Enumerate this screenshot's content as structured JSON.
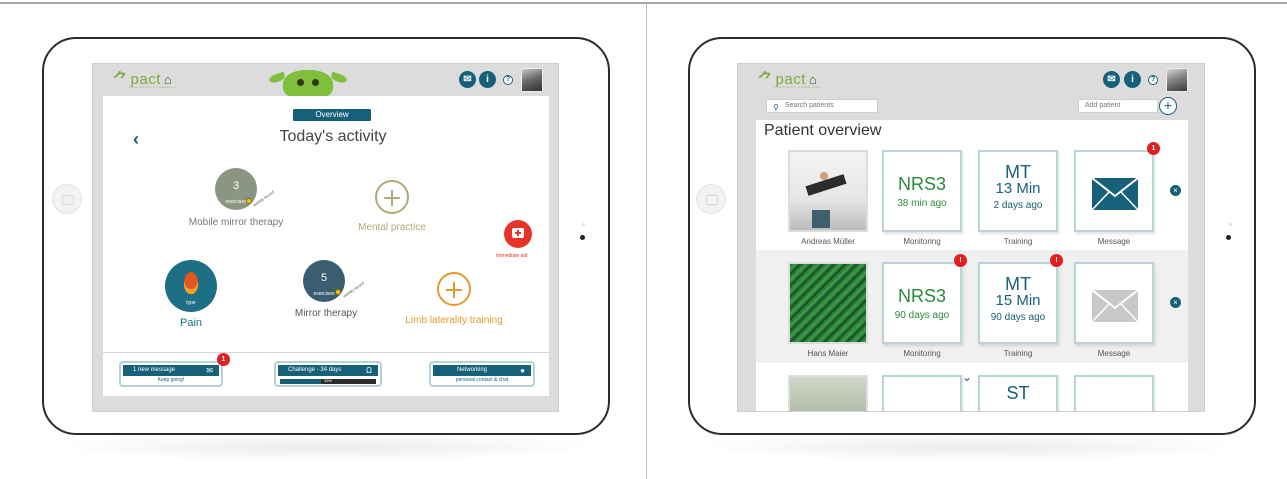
{
  "left_tablet": {
    "overview_pill": "Overview",
    "title": "Today's activity",
    "back_glyph": "‹",
    "mobile_mirror": {
      "count": "3",
      "unit": "exercises",
      "note": "weekly record",
      "label": "Mobile mirror therapy",
      "color": "#8a9682"
    },
    "mental_practice": {
      "label": "Mental practice",
      "color": "#b3a877"
    },
    "immediate_aid": {
      "label": "Immediate aid",
      "color": "#e7342a"
    },
    "pain": {
      "sub": "type",
      "label": "Pain",
      "color": "#1c6f84"
    },
    "mirror_therapy": {
      "count": "5",
      "unit": "exercises",
      "note": "weekly record",
      "label": "Mirror therapy",
      "color": "#3b5d70"
    },
    "limb_laterality": {
      "label": "Limb laterality training",
      "color": "#e39b2e"
    },
    "message_card": {
      "title": "1 new message",
      "sub": "Keep going!",
      "badge": "1"
    },
    "challenge_card": {
      "title": "Challenge - 34 days",
      "progress_text": "43%",
      "progress": 0.43
    },
    "networking_card": {
      "title": "Networking",
      "sub": "personal contact & chat"
    }
  },
  "header": {
    "logo": "pact",
    "logo_sub": "physiotherapy & therapeutics",
    "mail_icon": "envelope-icon",
    "info_icon": "info-icon",
    "help_icon": "help-icon",
    "help_glyph": "?",
    "info_glyph": "i",
    "mail_glyph": "✉"
  },
  "right_tablet": {
    "search_placeholder": "Search patients",
    "add_placeholder": "Add patient",
    "add_glyph": "+",
    "title": "Patient overview",
    "remove_glyph": "×",
    "patients": [
      {
        "name": "Andreas Müller",
        "monitoring_value": "NRS3",
        "monitoring_time": "38 min ago",
        "training_value": "MT",
        "training_duration": "13 Min",
        "training_time": "2 days ago",
        "message_badge": "1"
      },
      {
        "name": "Hans Maier",
        "monitoring_value": "NRS3",
        "monitoring_time": "90 days ago",
        "training_value": "MT",
        "training_duration": "15 Min",
        "training_time": "90 days ago",
        "alert_badge": "!"
      }
    ],
    "third_row_training": "ST",
    "col_labels": {
      "monitoring": "Monitoring",
      "training": "Training",
      "message": "Message"
    }
  },
  "colors": {
    "teal": "#17607a",
    "green_text": "#2b8a3a",
    "alert_red": "#e02020"
  }
}
